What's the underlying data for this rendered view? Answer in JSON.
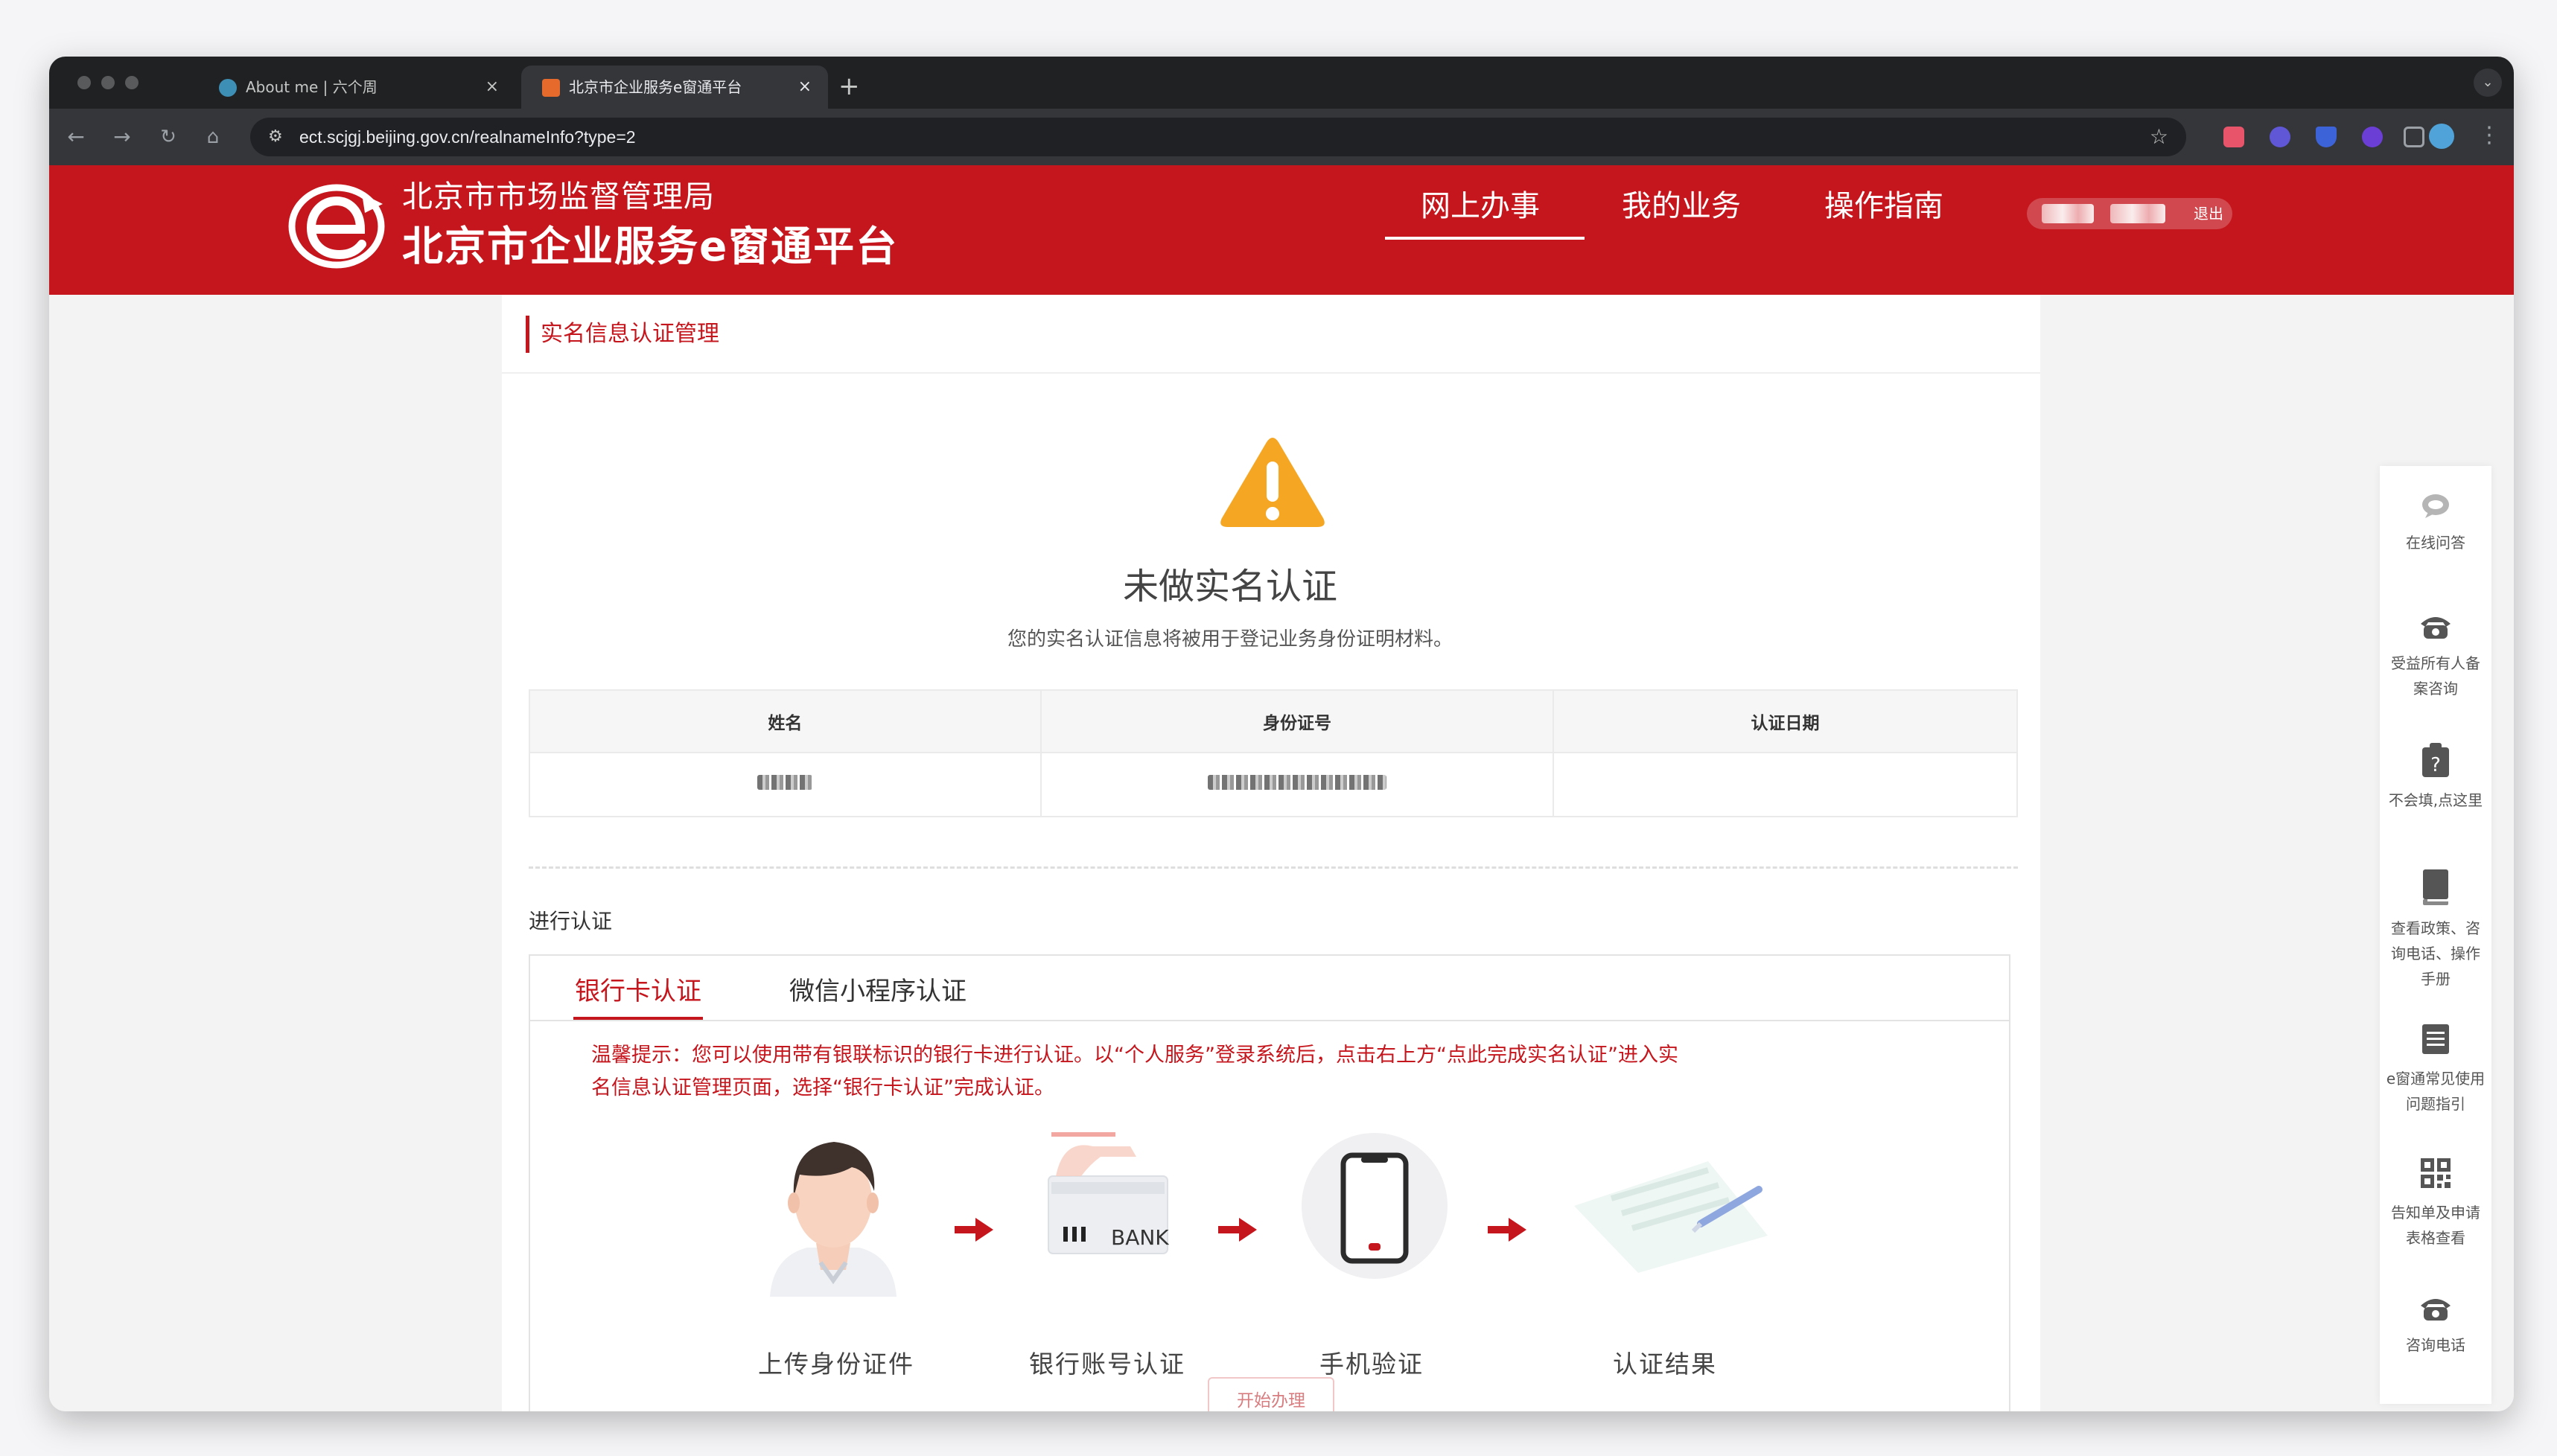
{
  "browser": {
    "tabs": [
      {
        "title": "About me | 六个周",
        "active": false
      },
      {
        "title": "北京市企业服务e窗通平台",
        "active": true
      }
    ],
    "new_tab": "+",
    "tab_close": "×",
    "url": "ect.scjgj.beijing.gov.cn/realnameInfo?type=2"
  },
  "header": {
    "agency": "北京市市场监督管理局",
    "platform": "北京市企业服务e窗通平台",
    "nav": [
      "网上办事",
      "我的业务",
      "操作指南"
    ],
    "active_nav": "网上办事",
    "logout": "退出"
  },
  "page": {
    "breadcrumb": "实名信息认证管理",
    "status_title": "未做实名认证",
    "status_desc": "您的实名认证信息将被用于登记业务身份证明材料。",
    "table": {
      "columns": [
        "姓名",
        "身份证号",
        "认证日期"
      ],
      "row": [
        "",
        "",
        ""
      ]
    },
    "section_label": "进行认证",
    "auth_tabs": [
      "银行卡认证",
      "微信小程序认证"
    ],
    "tip_line1": "温馨提示：您可以使用带有银联标识的银行卡进行认证。以“个人服务”登录系统后，点击右上方“点此完成实名认证”进入实",
    "tip_line2": "名信息认证管理页面，选择“银行卡认证”完成认证。",
    "steps": [
      "上传身份证件",
      "银行账号认证",
      "手机验证",
      "认证结果"
    ],
    "bank_text": "BANK",
    "start_button": "开始办理"
  },
  "sidebar": [
    {
      "label": "在线问答",
      "icon": "chat-bubble-icon"
    },
    {
      "label": "受益所有人备案咨询",
      "icon": "telephone-icon"
    },
    {
      "label": "不会填,点这里",
      "icon": "question-clipboard-icon"
    },
    {
      "label": "查看政策、咨询电话、操作手册",
      "icon": "book-icon"
    },
    {
      "label": "e窗通常见使用问题指引",
      "icon": "document-icon"
    },
    {
      "label": "告知单及申请表格查看",
      "icon": "qr-code-icon"
    },
    {
      "label": "咨询电话",
      "icon": "telephone-icon"
    }
  ],
  "colors": {
    "brand_red": "#c5161d",
    "warning_orange": "#f5a623",
    "chrome_dark": "#1f2123"
  }
}
